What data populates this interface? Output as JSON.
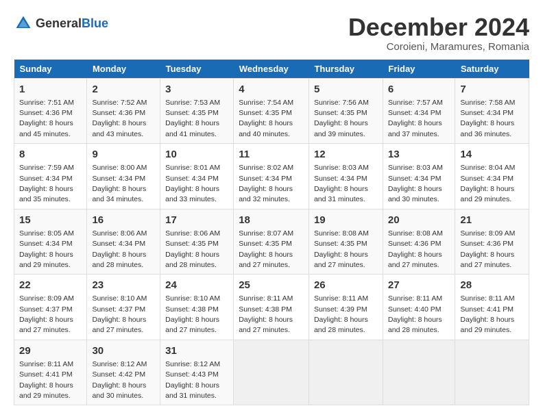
{
  "header": {
    "logo_general": "General",
    "logo_blue": "Blue",
    "month": "December 2024",
    "location": "Coroieni, Maramures, Romania"
  },
  "days_of_week": [
    "Sunday",
    "Monday",
    "Tuesday",
    "Wednesday",
    "Thursday",
    "Friday",
    "Saturday"
  ],
  "weeks": [
    [
      {
        "day": "1",
        "sunrise": "7:51 AM",
        "sunset": "4:36 PM",
        "daylight": "8 hours and 45 minutes."
      },
      {
        "day": "2",
        "sunrise": "7:52 AM",
        "sunset": "4:36 PM",
        "daylight": "8 hours and 43 minutes."
      },
      {
        "day": "3",
        "sunrise": "7:53 AM",
        "sunset": "4:35 PM",
        "daylight": "8 hours and 41 minutes."
      },
      {
        "day": "4",
        "sunrise": "7:54 AM",
        "sunset": "4:35 PM",
        "daylight": "8 hours and 40 minutes."
      },
      {
        "day": "5",
        "sunrise": "7:56 AM",
        "sunset": "4:35 PM",
        "daylight": "8 hours and 39 minutes."
      },
      {
        "day": "6",
        "sunrise": "7:57 AM",
        "sunset": "4:34 PM",
        "daylight": "8 hours and 37 minutes."
      },
      {
        "day": "7",
        "sunrise": "7:58 AM",
        "sunset": "4:34 PM",
        "daylight": "8 hours and 36 minutes."
      }
    ],
    [
      {
        "day": "8",
        "sunrise": "7:59 AM",
        "sunset": "4:34 PM",
        "daylight": "8 hours and 35 minutes."
      },
      {
        "day": "9",
        "sunrise": "8:00 AM",
        "sunset": "4:34 PM",
        "daylight": "8 hours and 34 minutes."
      },
      {
        "day": "10",
        "sunrise": "8:01 AM",
        "sunset": "4:34 PM",
        "daylight": "8 hours and 33 minutes."
      },
      {
        "day": "11",
        "sunrise": "8:02 AM",
        "sunset": "4:34 PM",
        "daylight": "8 hours and 32 minutes."
      },
      {
        "day": "12",
        "sunrise": "8:03 AM",
        "sunset": "4:34 PM",
        "daylight": "8 hours and 31 minutes."
      },
      {
        "day": "13",
        "sunrise": "8:03 AM",
        "sunset": "4:34 PM",
        "daylight": "8 hours and 30 minutes."
      },
      {
        "day": "14",
        "sunrise": "8:04 AM",
        "sunset": "4:34 PM",
        "daylight": "8 hours and 29 minutes."
      }
    ],
    [
      {
        "day": "15",
        "sunrise": "8:05 AM",
        "sunset": "4:34 PM",
        "daylight": "8 hours and 29 minutes."
      },
      {
        "day": "16",
        "sunrise": "8:06 AM",
        "sunset": "4:34 PM",
        "daylight": "8 hours and 28 minutes."
      },
      {
        "day": "17",
        "sunrise": "8:06 AM",
        "sunset": "4:35 PM",
        "daylight": "8 hours and 28 minutes."
      },
      {
        "day": "18",
        "sunrise": "8:07 AM",
        "sunset": "4:35 PM",
        "daylight": "8 hours and 27 minutes."
      },
      {
        "day": "19",
        "sunrise": "8:08 AM",
        "sunset": "4:35 PM",
        "daylight": "8 hours and 27 minutes."
      },
      {
        "day": "20",
        "sunrise": "8:08 AM",
        "sunset": "4:36 PM",
        "daylight": "8 hours and 27 minutes."
      },
      {
        "day": "21",
        "sunrise": "8:09 AM",
        "sunset": "4:36 PM",
        "daylight": "8 hours and 27 minutes."
      }
    ],
    [
      {
        "day": "22",
        "sunrise": "8:09 AM",
        "sunset": "4:37 PM",
        "daylight": "8 hours and 27 minutes."
      },
      {
        "day": "23",
        "sunrise": "8:10 AM",
        "sunset": "4:37 PM",
        "daylight": "8 hours and 27 minutes."
      },
      {
        "day": "24",
        "sunrise": "8:10 AM",
        "sunset": "4:38 PM",
        "daylight": "8 hours and 27 minutes."
      },
      {
        "day": "25",
        "sunrise": "8:11 AM",
        "sunset": "4:38 PM",
        "daylight": "8 hours and 27 minutes."
      },
      {
        "day": "26",
        "sunrise": "8:11 AM",
        "sunset": "4:39 PM",
        "daylight": "8 hours and 28 minutes."
      },
      {
        "day": "27",
        "sunrise": "8:11 AM",
        "sunset": "4:40 PM",
        "daylight": "8 hours and 28 minutes."
      },
      {
        "day": "28",
        "sunrise": "8:11 AM",
        "sunset": "4:41 PM",
        "daylight": "8 hours and 29 minutes."
      }
    ],
    [
      {
        "day": "29",
        "sunrise": "8:11 AM",
        "sunset": "4:41 PM",
        "daylight": "8 hours and 29 minutes."
      },
      {
        "day": "30",
        "sunrise": "8:12 AM",
        "sunset": "4:42 PM",
        "daylight": "8 hours and 30 minutes."
      },
      {
        "day": "31",
        "sunrise": "8:12 AM",
        "sunset": "4:43 PM",
        "daylight": "8 hours and 31 minutes."
      },
      null,
      null,
      null,
      null
    ]
  ],
  "labels": {
    "sunrise": "Sunrise:",
    "sunset": "Sunset:",
    "daylight": "Daylight:"
  }
}
